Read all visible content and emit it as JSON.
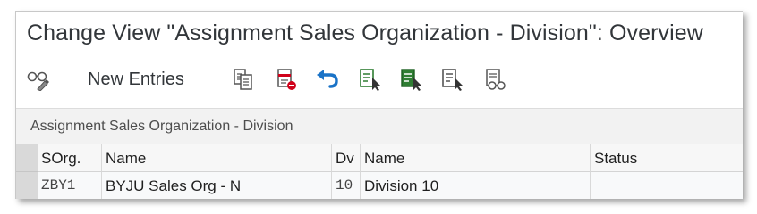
{
  "window": {
    "title": "Change View \"Assignment Sales Organization - Division\": Overview"
  },
  "toolbar": {
    "items": [
      {
        "icon": "display-change-icon"
      },
      {
        "label": "New Entries"
      },
      {
        "icon": "copy-as-icon"
      },
      {
        "icon": "delete-icon"
      },
      {
        "icon": "undo-change-icon"
      },
      {
        "icon": "select-all-icon"
      },
      {
        "icon": "select-block-icon"
      },
      {
        "icon": "deselect-all-icon"
      },
      {
        "icon": "print-field-list-icon"
      }
    ],
    "new_entries_label": "New Entries"
  },
  "section": {
    "title": "Assignment Sales Organization - Division"
  },
  "table": {
    "columns": [
      "SOrg.",
      "Name",
      "Dv",
      "Name",
      "Status"
    ],
    "rows": [
      {
        "sorg": "ZBY1",
        "sorg_name": "BYJU Sales Org - N",
        "dv": "10",
        "dv_name": "Division 10",
        "status": ""
      }
    ]
  },
  "colors": {
    "title_text": "#32363a",
    "content_bg": "#f2f2f2",
    "undo_blue": "#1a73c7",
    "delete_red": "#d0021b",
    "select_green": "#2e7d32"
  }
}
